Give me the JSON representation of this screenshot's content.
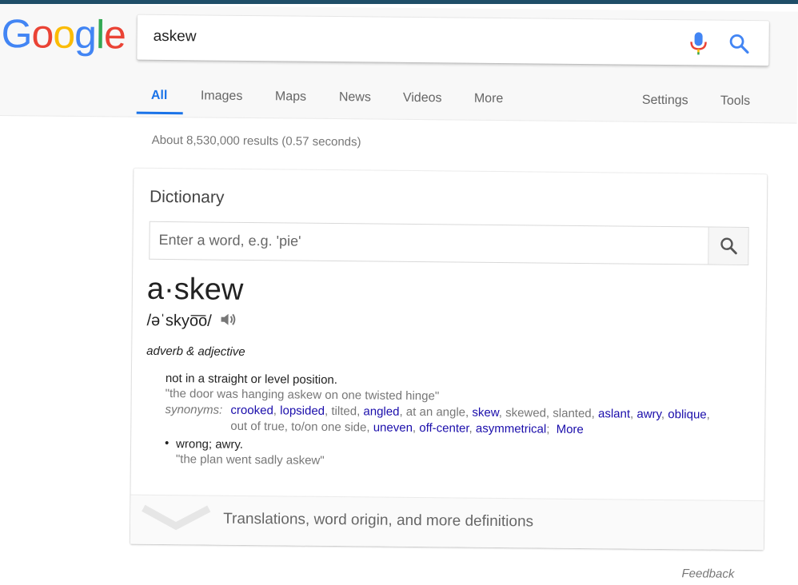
{
  "logo": {
    "letters": [
      "G",
      "o",
      "o",
      "g",
      "l",
      "e"
    ],
    "colors": [
      "#4285f4",
      "#ea4335",
      "#fbbc05",
      "#4285f4",
      "#34a853",
      "#ea4335"
    ]
  },
  "search": {
    "query": "askew"
  },
  "tabs": {
    "all": "All",
    "images": "Images",
    "maps": "Maps",
    "news": "News",
    "videos": "Videos",
    "more": "More",
    "settings": "Settings",
    "tools": "Tools"
  },
  "result_stats": "About 8,530,000 results (0.57 seconds)",
  "dictionary": {
    "title": "Dictionary",
    "input_placeholder": "Enter a word, e.g. 'pie'",
    "headword": "a·skew",
    "pronunciation": "/əˈskyo͞o/",
    "part_of_speech": "adverb & adjective",
    "sense1": {
      "definition": "not in a straight or level position.",
      "example": "\"the door was hanging askew on one twisted hinge\"",
      "synonyms_label": "synonyms:",
      "synonyms": [
        {
          "text": "crooked",
          "link": true
        },
        {
          "text": "lopsided",
          "link": true
        },
        {
          "text": "tilted",
          "link": false
        },
        {
          "text": "angled",
          "link": true
        },
        {
          "text": "at an angle",
          "link": false
        },
        {
          "text": "skew",
          "link": true
        },
        {
          "text": "skewed",
          "link": false
        },
        {
          "text": "slanted",
          "link": false
        },
        {
          "text": "aslant",
          "link": true
        },
        {
          "text": "awry",
          "link": true
        },
        {
          "text": "oblique",
          "link": true
        },
        {
          "text": "out of true",
          "link": false
        },
        {
          "text": "to/on one side",
          "link": false
        },
        {
          "text": "uneven",
          "link": true
        },
        {
          "text": "off-center",
          "link": true
        },
        {
          "text": "asymmetrical",
          "link": true
        }
      ],
      "more_label": "More"
    },
    "sense2": {
      "bullet": "•",
      "definition": "wrong; awry.",
      "example": "\"the plan went sadly askew\""
    },
    "footer_text": "Translations, word origin, and more definitions"
  },
  "feedback": "Feedback",
  "colors": {
    "accent_blue": "#1a73e8",
    "link": "#1a0dab",
    "top_strip": "#1f4e68"
  },
  "icons": [
    "mic-icon",
    "search-icon",
    "speaker-icon",
    "chevron-down-icon"
  ]
}
